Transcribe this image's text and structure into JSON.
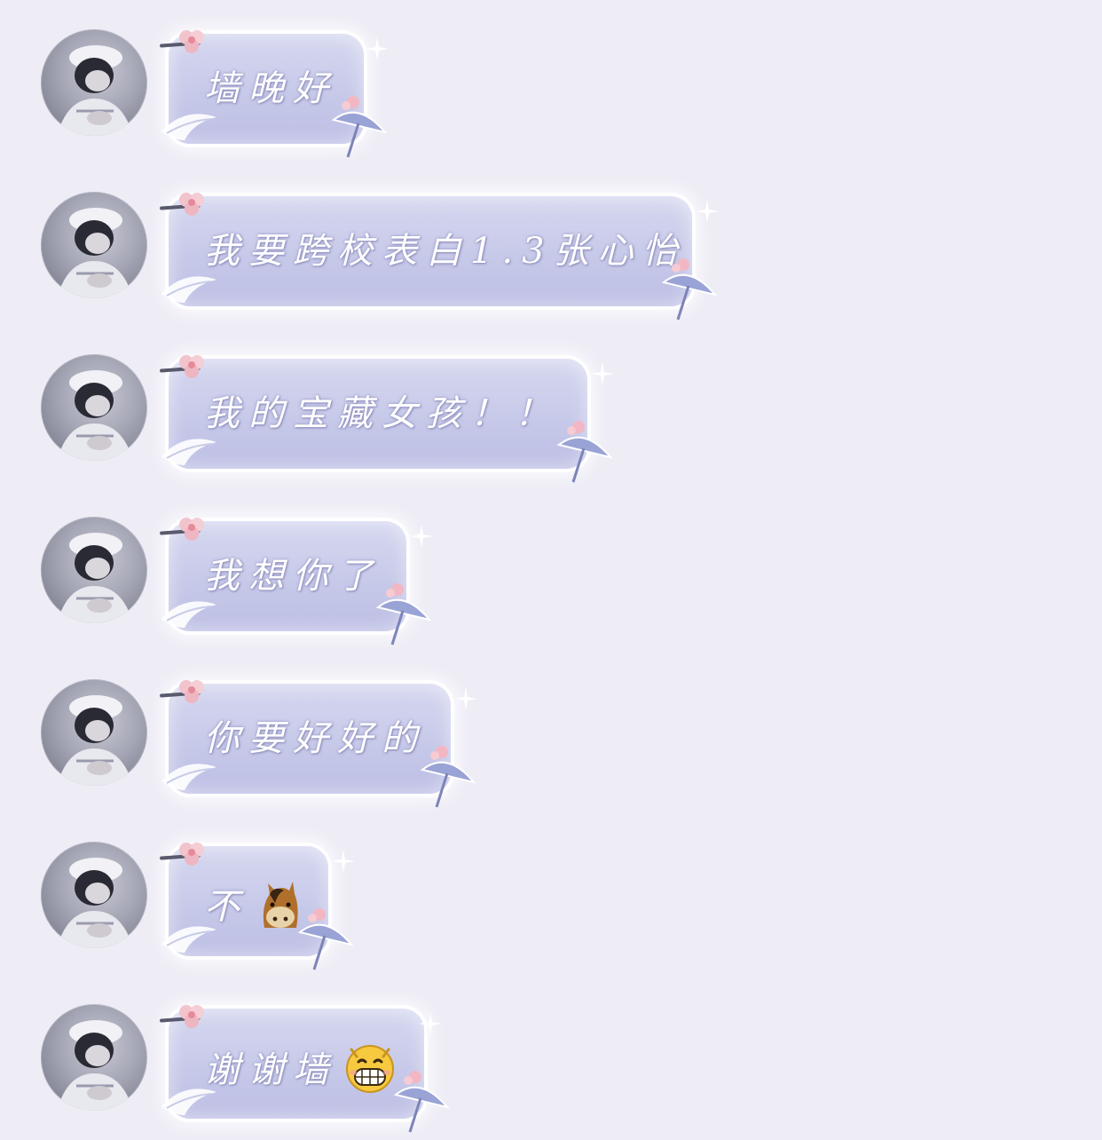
{
  "colors": {
    "background": "#eeedf6",
    "bubble": "#c7c9e9",
    "bubble_text": "#ffffff"
  },
  "messages": [
    {
      "text": "墙晚好",
      "emoji": ""
    },
    {
      "text": "我要跨校表白1.3张心怡",
      "emoji": ""
    },
    {
      "text": "我的宝藏女孩！！",
      "emoji": ""
    },
    {
      "text": "我想你了",
      "emoji": ""
    },
    {
      "text": "你要好好的",
      "emoji": ""
    },
    {
      "text": "不",
      "emoji": "horse-face-icon"
    },
    {
      "text": "谢谢墙",
      "emoji": "grinning-face-icon"
    }
  ]
}
